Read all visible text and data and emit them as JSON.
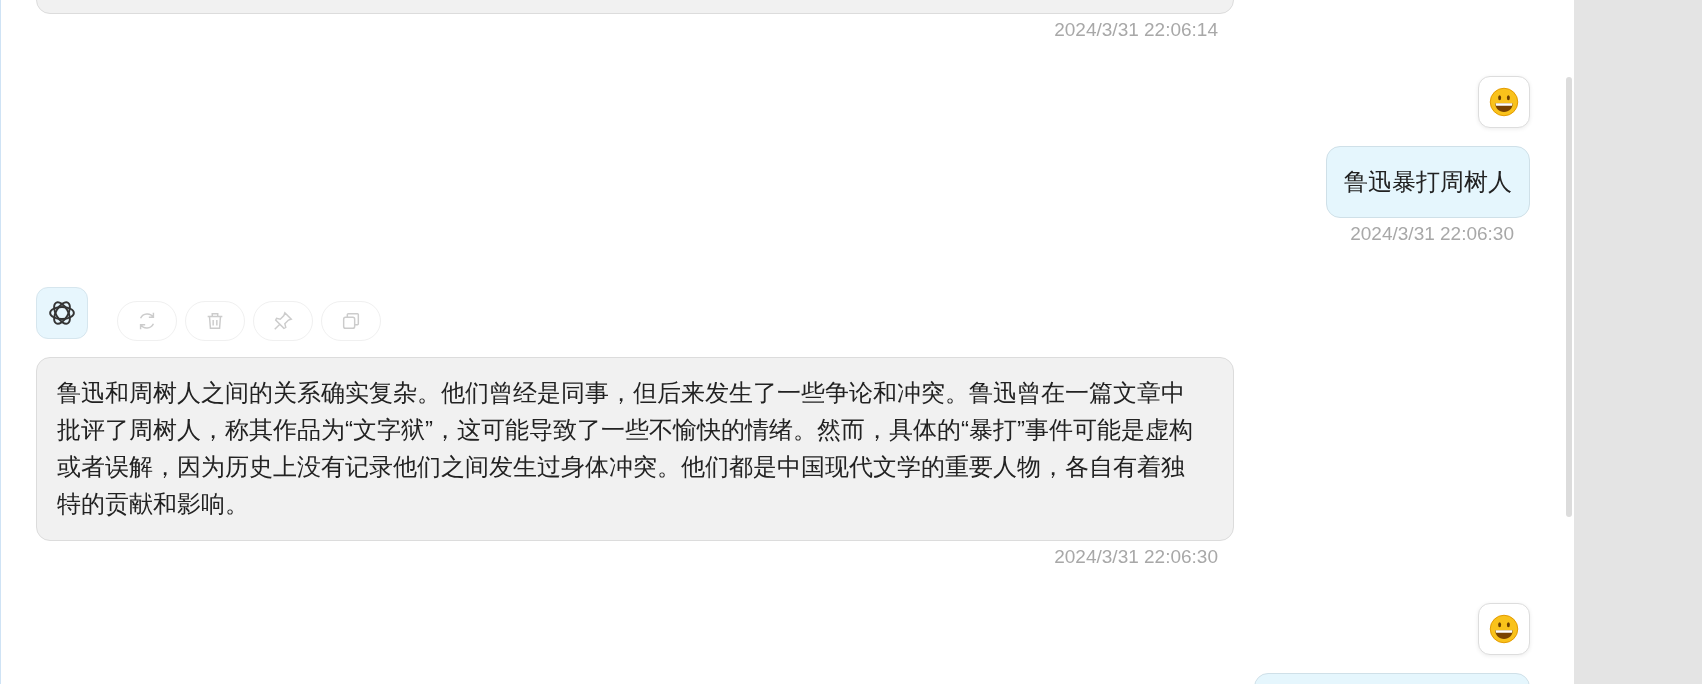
{
  "messages": [
    {
      "kind": "assistant",
      "partial": true,
      "time": "2024/3/31 22:06:14"
    },
    {
      "kind": "user",
      "partial": false,
      "text": "鲁迅暴打周树人",
      "time": "2024/3/31 22:06:30"
    },
    {
      "kind": "assistant",
      "partial": false,
      "actions": [
        {
          "kind": "regenerate"
        },
        {
          "kind": "delete"
        },
        {
          "kind": "pin"
        },
        {
          "kind": "copy"
        }
      ],
      "text": "鲁迅和周树人之间的关系确实复杂。他们曾经是同事，但后来发生了一些争论和冲突。鲁迅曾在一篇文章中批评了周树人，称其作品为“文字狱”，这可能导致了一些不愉快的情绪。然而，具体的“暴打”事件可能是虚构或者误解，因为历史上没有记录他们之间发生过身体冲突。他们都是中国现代文学的重要人物，各自有着独特的贡献和影响。",
      "time": "2024/3/31 22:06:30"
    },
    {
      "kind": "user",
      "partial": true
    }
  ]
}
